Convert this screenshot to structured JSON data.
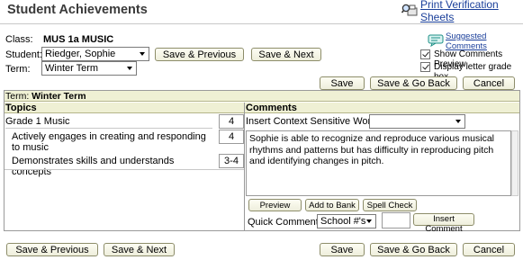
{
  "page": {
    "title": "Student Achievements",
    "print_link": "Print Verification Sheets",
    "suggested_comments": "Suggested Comments"
  },
  "form": {
    "class_label": "Class:",
    "class_value": "MUS 1a MUSIC",
    "student_label": "Student:",
    "student_value": "Riedger, Sophie",
    "term_label": "Term:",
    "term_value": "Winter Term"
  },
  "top_buttons": {
    "save_previous": "Save & Previous",
    "save_next": "Save & Next",
    "save": "Save",
    "save_go_back": "Save & Go Back",
    "cancel": "Cancel"
  },
  "options": {
    "show_comments_preview": "Show Comments Preview",
    "show_comments_preview_checked": true,
    "display_letter_grade": "Display letter grade box",
    "display_letter_grade_checked": true
  },
  "grid": {
    "term_prefix": "Term:",
    "term_name": "Winter Term",
    "topics_header": "Topics",
    "comments_header": "Comments",
    "topics": [
      {
        "label": "Grade 1 Music",
        "grade": "4"
      },
      {
        "label": "Actively engages in creating and responding to music",
        "grade": "4"
      },
      {
        "label": "Demonstrates skills and understands concepts",
        "grade": "3-4"
      }
    ]
  },
  "comments": {
    "insert_word_label": "Insert Context Sensitive Word:",
    "insert_word_value": "",
    "text": "Sophie is able to recognize and reproduce various musical rhythms and patterns but has difficulty in reproducing pitch and identifying changes in pitch.",
    "preview": "Preview",
    "add_to_bank": "Add to Bank",
    "spell_check": "Spell Check",
    "quick_comment_label": "Quick Comment:",
    "quick_comment_value": "School #'s",
    "quick_comment_number": "",
    "insert_comment": "Insert Comment"
  },
  "bottom_buttons": {
    "save_previous": "Save & Previous",
    "save_next": "Save & Next",
    "save": "Save",
    "save_go_back": "Save & Go Back",
    "cancel": "Cancel"
  }
}
